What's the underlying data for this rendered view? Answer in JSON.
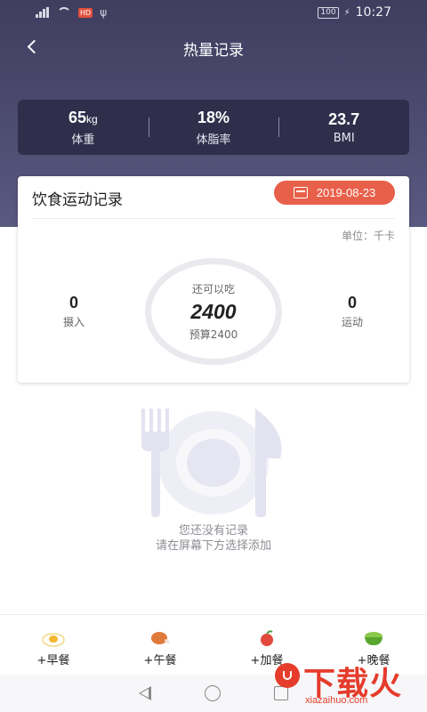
{
  "status_bar": {
    "hd_badge": "HD",
    "battery": "100",
    "time": "10:27"
  },
  "header": {
    "title": "热量记录"
  },
  "stats": [
    {
      "value": "65",
      "unit": "kg",
      "label": "体重"
    },
    {
      "value": "18%",
      "unit": "",
      "label": "体脂率"
    },
    {
      "value": "23.7",
      "unit": "",
      "label": "BMI"
    }
  ],
  "diet_card": {
    "title": "饮食运动记录",
    "date": "2019-08-23",
    "unit_text": "单位：千卡",
    "intake": {
      "value": "0",
      "label": "摄入"
    },
    "exercise": {
      "value": "0",
      "label": "运动"
    },
    "remaining_label": "还可以吃",
    "remaining_value": "2400",
    "budget_text": "预算2400"
  },
  "empty_state": {
    "line1": "您还没有记录",
    "line2": "请在屏幕下方选择添加"
  },
  "bottom_bar": {
    "breakfast": "+早餐",
    "lunch": "+午餐",
    "snack": "+加餐",
    "dinner": "+晚餐"
  },
  "watermark": {
    "text": "下载火",
    "url": "xiazaihuo.com"
  },
  "colors": {
    "header_bg": "#4e4d72",
    "stats_card": "#2f2e4b",
    "accent": "#e8604a"
  }
}
